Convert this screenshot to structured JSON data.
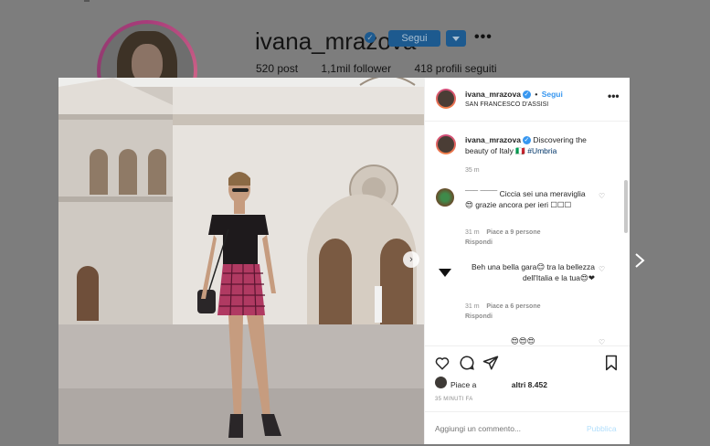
{
  "profile": {
    "username": "ivana_mrazova",
    "follow_button": "Segui",
    "stats": {
      "posts": "520 post",
      "followers": "1,1mil follower",
      "following": "418 profili seguiti"
    }
  },
  "post": {
    "header": {
      "username": "ivana_mrazova",
      "separator": "•",
      "follow_label": "Segui",
      "location": "SAN FRANCESCO D'ASSISI"
    },
    "caption": {
      "username": "ivana_mrazova",
      "text": "Discovering the beauty of Italy 🇮🇹 ",
      "hashtag": "#Umbria",
      "time": "35 m"
    },
    "comments": [
      {
        "username": "",
        "text_line": "¯¯¯ ¯¯¯¯ Ciccia sei una meraviglia 😍 grazie ancora per ieri ☐☐☐",
        "time": "31 m",
        "likes": "Piace a 9 persone",
        "reply": "Rispondi"
      },
      {
        "username": "",
        "text_line": "Beh una bella gara😊 tra la bellezza dell'Italia e la tua😍❤",
        "time": "31 m",
        "likes": "Piace a 6 persone",
        "reply": "Rispondi"
      },
      {
        "username": "",
        "text_line": "😍😍😍",
        "time": "",
        "likes": "",
        "reply": ""
      }
    ],
    "likes_prefix": "Piace a",
    "likes_suffix": "altri 8.452",
    "time_ago": "35 MINUTI FA",
    "comment_placeholder": "Aggiungi un commento...",
    "publish_label": "Pubblica"
  },
  "icons": {
    "verified": "verified-check-icon",
    "more": "more-horizontal-icon",
    "heart": "heart-icon",
    "comment": "comment-bubble-icon",
    "share": "paper-plane-icon",
    "save": "bookmark-icon",
    "next": "chevron-right-icon"
  },
  "colors": {
    "accent": "#3897f0",
    "follow_dimmed": "#1d5a8f",
    "overlay": "#7d7d7d"
  }
}
